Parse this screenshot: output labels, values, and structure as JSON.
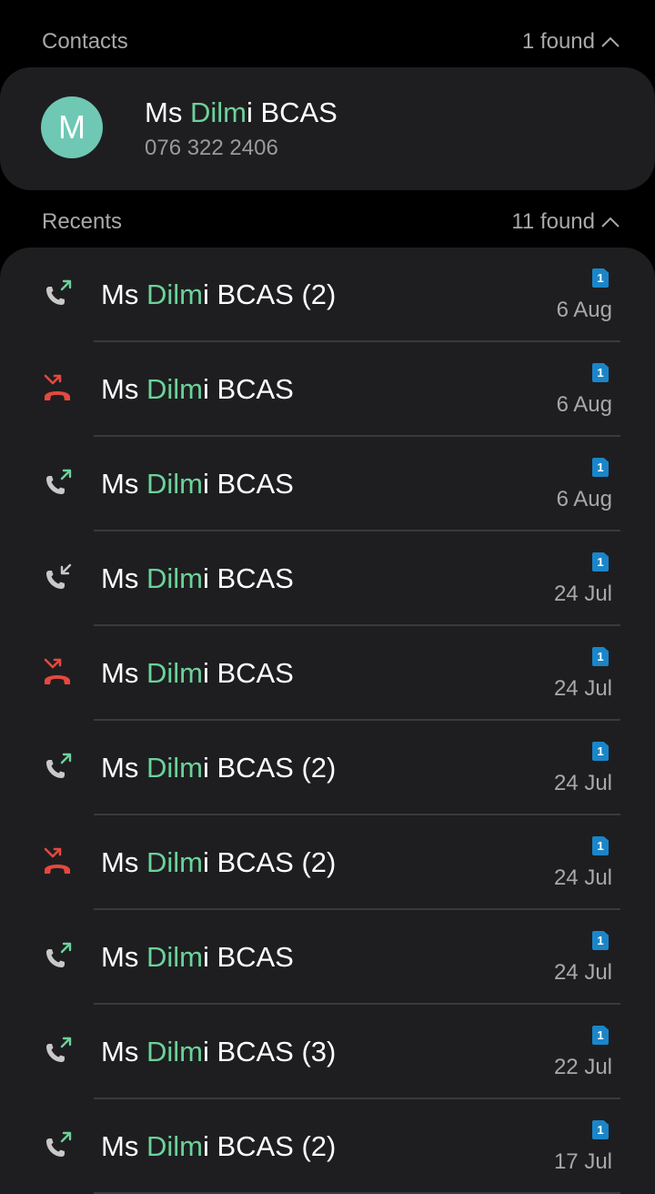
{
  "contacts": {
    "title": "Contacts",
    "found": "1 found",
    "item": {
      "avatar_letter": "M",
      "name_prefix": "Ms ",
      "name_match": "Dilm",
      "name_suffix": "i BCAS",
      "number": "076 322 2406"
    }
  },
  "recents": {
    "title": "Recents",
    "found": "11 found",
    "items": [
      {
        "type": "outgoing",
        "prefix": "Ms ",
        "match": "Dilm",
        "suffix": "i BCAS (2)",
        "sim": "1",
        "date": "6 Aug"
      },
      {
        "type": "missed",
        "prefix": "Ms ",
        "match": "Dilm",
        "suffix": "i BCAS",
        "sim": "1",
        "date": "6 Aug"
      },
      {
        "type": "outgoing",
        "prefix": "Ms ",
        "match": "Dilm",
        "suffix": "i BCAS",
        "sim": "1",
        "date": "6 Aug"
      },
      {
        "type": "incoming",
        "prefix": "Ms ",
        "match": "Dilm",
        "suffix": "i BCAS",
        "sim": "1",
        "date": "24 Jul"
      },
      {
        "type": "missed",
        "prefix": "Ms ",
        "match": "Dilm",
        "suffix": "i BCAS",
        "sim": "1",
        "date": "24 Jul"
      },
      {
        "type": "outgoing",
        "prefix": "Ms ",
        "match": "Dilm",
        "suffix": "i BCAS (2)",
        "sim": "1",
        "date": "24 Jul"
      },
      {
        "type": "missed",
        "prefix": "Ms ",
        "match": "Dilm",
        "suffix": "i BCAS (2)",
        "sim": "1",
        "date": "24 Jul"
      },
      {
        "type": "outgoing",
        "prefix": "Ms ",
        "match": "Dilm",
        "suffix": "i BCAS",
        "sim": "1",
        "date": "24 Jul"
      },
      {
        "type": "outgoing",
        "prefix": "Ms ",
        "match": "Dilm",
        "suffix": "i BCAS (3)",
        "sim": "1",
        "date": "22 Jul"
      },
      {
        "type": "outgoing",
        "prefix": "Ms ",
        "match": "Dilm",
        "suffix": "i BCAS (2)",
        "sim": "1",
        "date": "17 Jul"
      }
    ]
  },
  "colors": {
    "highlight": "#6cd29a",
    "missed": "#e5483f",
    "sim_badge": "#1a86c9",
    "avatar": "#6ec8b4"
  }
}
